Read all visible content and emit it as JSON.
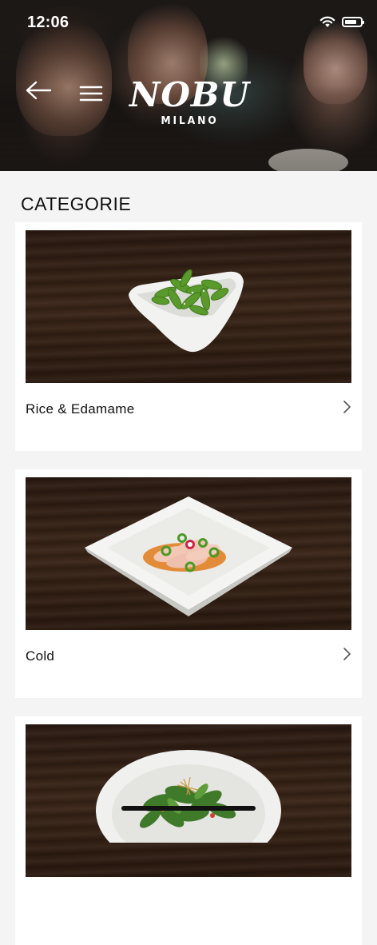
{
  "status_bar": {
    "time": "12:06"
  },
  "header": {
    "logo_main": "NOBU",
    "logo_sub": "MILANO"
  },
  "section": {
    "title": "CATEGORIE"
  },
  "categories": [
    {
      "label": "Rice & Edamame"
    },
    {
      "label": "Cold"
    },
    {
      "label": ""
    }
  ],
  "icons": {
    "back": "arrow-left-icon",
    "menu": "hamburger-menu-icon",
    "chevron": "chevron-right-icon",
    "wifi": "wifi-icon",
    "battery": "battery-icon"
  },
  "colors": {
    "background": "#f4f4f4",
    "card": "#ffffff",
    "text": "#111111",
    "wood": "#2b1b12"
  }
}
